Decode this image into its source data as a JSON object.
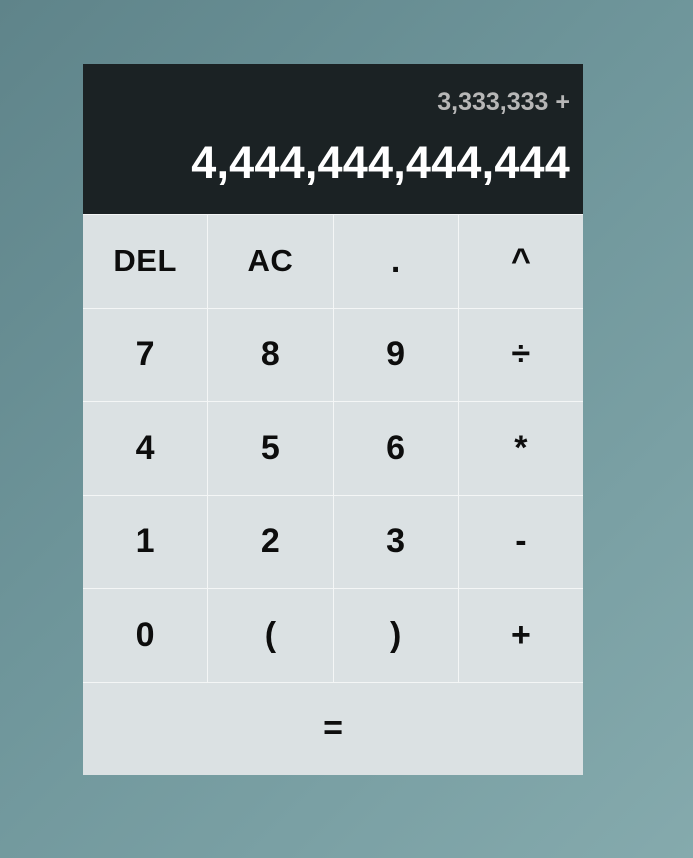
{
  "display": {
    "previous_operand": "3,333,333 +",
    "current_operand": "4,444,444,444,444"
  },
  "keys": {
    "del": "DEL",
    "ac": "AC",
    "decimal": ".",
    "power": "^",
    "seven": "7",
    "eight": "8",
    "nine": "9",
    "divide": "÷",
    "four": "4",
    "five": "5",
    "six": "6",
    "multiply": "*",
    "one": "1",
    "two": "2",
    "three": "3",
    "subtract": "-",
    "zero": "0",
    "open_paren": "(",
    "close_paren": ")",
    "add": "+",
    "equals": "="
  },
  "colors": {
    "display_background": "#1b2224",
    "key_background": "#dbe1e3",
    "grid_lines": "#f4f6f6",
    "previous_operand_text": "#b7b7b7",
    "current_operand_text": "#ffffff"
  }
}
